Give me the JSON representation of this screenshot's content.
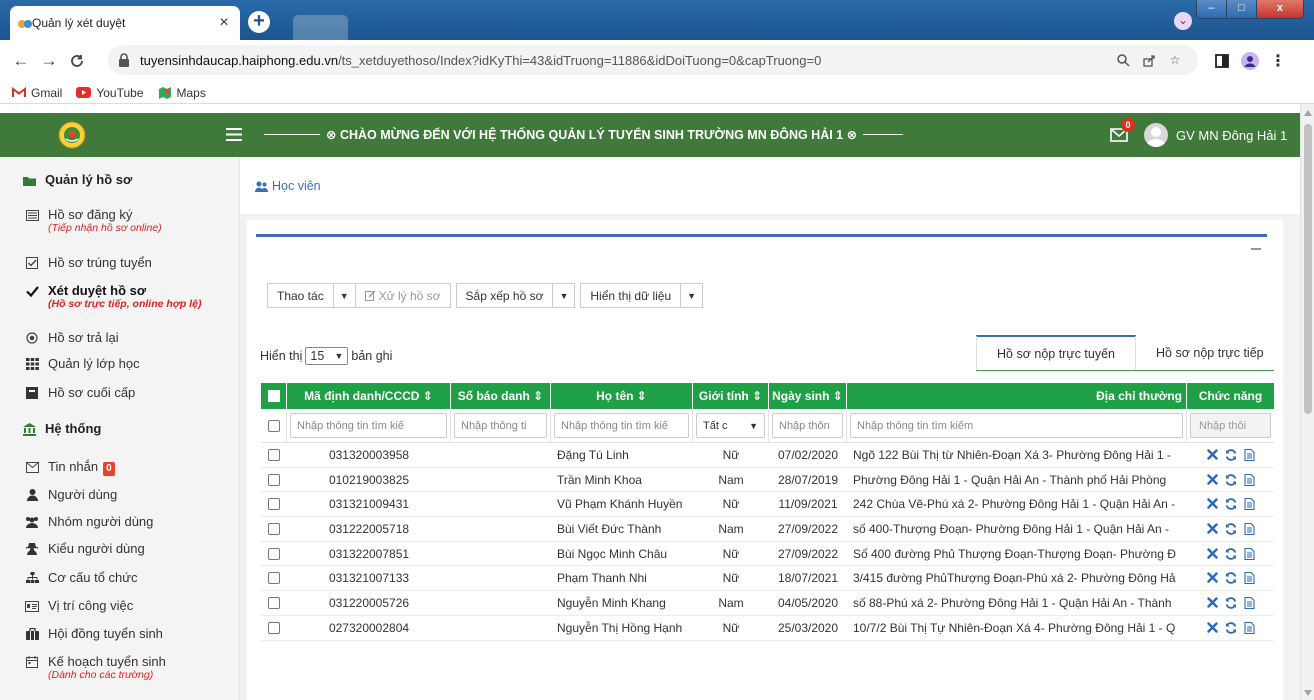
{
  "browser": {
    "tab_title": "Quản lý xét duyệt",
    "url_host": "tuyensinhdaucap.haiphong.edu.vn",
    "url_path": "/ts_xetduyethoso/Index?idKyThi=43&idTruong=11886&idDoiTuong=0&capTruong=0",
    "bookmarks": [
      "Gmail",
      "YouTube",
      "Maps"
    ]
  },
  "header": {
    "welcome": "⊗ CHÀO MỪNG ĐẾN VỚI HỆ THỐNG QUẢN LÝ TUYỂN SINH TRƯỜNG MN ĐÔNG HẢI 1 ⊗",
    "mail_count": "0",
    "user_name": "GV MN Đông Hải 1"
  },
  "sidebar": {
    "section1": "Quản lý hồ sơ",
    "items1": [
      {
        "label": "Hồ sơ đăng ký",
        "sub": "(Tiếp nhận hồ sơ online)"
      },
      {
        "label": "Hồ sơ trúng tuyển",
        "sub": ""
      },
      {
        "label": "Xét duyệt hồ sơ",
        "sub": "(Hồ sơ trực tiếp, online hợp lệ)"
      },
      {
        "label": "Hồ sơ trả lại",
        "sub": ""
      },
      {
        "label": "Quản lý lớp học",
        "sub": ""
      },
      {
        "label": "Hồ sơ cuối cấp",
        "sub": ""
      }
    ],
    "section2": "Hệ thống",
    "items2": [
      {
        "label": "Tin nhắn",
        "badge": "0"
      },
      {
        "label": "Người dùng"
      },
      {
        "label": "Nhóm người dùng"
      },
      {
        "label": "Kiểu người dùng"
      },
      {
        "label": "Cơ cấu tổ chức"
      },
      {
        "label": "Vị trí công việc"
      },
      {
        "label": "Hội đồng tuyển sinh"
      },
      {
        "label": "Kế hoạch tuyển sinh",
        "sub": "(Dành cho các trường)"
      }
    ]
  },
  "breadcrumb": "Học viên",
  "toolbar": {
    "actions": "Thao tác",
    "process": "Xử lý hồ sơ",
    "sort": "Sắp xếp hồ sơ",
    "display": "Hiển thị dữ liệu"
  },
  "length": {
    "prefix": "Hiển thị",
    "value": "15",
    "suffix": "bản ghi"
  },
  "tabs": [
    "Hồ sơ nộp trực tuyến",
    "Hồ sơ nộp trực tiếp"
  ],
  "table": {
    "headers": [
      "Mã định danh/CCCD ⇕",
      "Số báo danh ⇕",
      "Họ tên ⇕",
      "Giới tính ⇕",
      "Ngày sinh ⇕",
      "Địa chỉ thường",
      "Chức năng"
    ],
    "filters": [
      "Nhập thông tin tìm kiế",
      "Nhập thông ti",
      "Nhập thông tin tìm kiế",
      "Tất c",
      "Nhập thôn",
      "Nhập thông tin tìm kiếm",
      "Nhập thôi"
    ],
    "rows": [
      [
        "031320003958",
        "",
        "Đặng Tú Linh",
        "Nữ",
        "07/02/2020",
        "Ngõ 122 Bùi Thị từ Nhiên-Đoạn Xá 3- Phường Đông Hải 1 -"
      ],
      [
        "010219003825",
        "",
        "Trần Minh Khoa",
        "Nam",
        "28/07/2019",
        "Phường Đông Hải 1 - Quận Hải An - Thành phố Hải Phòng"
      ],
      [
        "031321009431",
        "",
        "Vũ Phạm Khánh Huyền",
        "Nữ",
        "11/09/2021",
        "242 Chùa Vẽ-Phú xá 2- Phường Đông Hải 1 - Quận Hải An -"
      ],
      [
        "031222005718",
        "",
        "Bùi Viết Đức Thành",
        "Nam",
        "27/09/2022",
        "số 400-Thượng Đoạn- Phường Đông Hải 1 - Quận Hải An - "
      ],
      [
        "031322007851",
        "",
        "Bùi Ngọc Minh Châu",
        "Nữ",
        "27/09/2022",
        "Số 400 đường Phủ Thượng Đoạn-Thượng Đoạn- Phường Đ"
      ],
      [
        "031321007133",
        "",
        "Phạm Thanh Nhi",
        "Nữ",
        "18/07/2021",
        "3/415 đường PhủThượng Đoạn-Phú xá 2- Phường Đông Hả"
      ],
      [
        "031220005726",
        "",
        "Nguyễn Minh Khang",
        "Nam",
        "04/05/2020",
        "số 88-Phú xá 2- Phường Đông Hải 1 - Quận Hải An - Thành"
      ],
      [
        "027320002804",
        "",
        "Nguyễn Thị Hồng Hạnh",
        "Nữ",
        "25/03/2020",
        "10/7/2 Bùi Thị Tự Nhiên-Đoạn Xá 4- Phường Đông Hải 1 - Q"
      ]
    ]
  }
}
